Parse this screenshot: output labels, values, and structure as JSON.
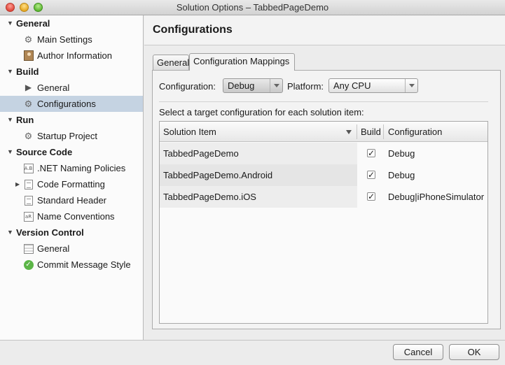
{
  "window": {
    "title": "Solution Options – TabbedPageDemo"
  },
  "sidebar": {
    "categories": [
      {
        "label": "General",
        "items": [
          {
            "label": "Main Settings",
            "icon": "gear-icon"
          },
          {
            "label": "Author Information",
            "icon": "author-icon"
          }
        ]
      },
      {
        "label": "Build",
        "items": [
          {
            "label": "General",
            "icon": "play-icon"
          },
          {
            "label": "Configurations",
            "icon": "gear-icon",
            "selected": true
          }
        ]
      },
      {
        "label": "Run",
        "items": [
          {
            "label": "Startup Project",
            "icon": "gear-icon"
          }
        ]
      },
      {
        "label": "Source Code",
        "items": [
          {
            "label": ".NET Naming Policies",
            "icon": "naming-policies-icon",
            "icon_text": "A.B"
          },
          {
            "label": "Code Formatting",
            "icon": "document-icon",
            "collapsed": true
          },
          {
            "label": "Standard Header",
            "icon": "document-icon"
          },
          {
            "label": "Name Conventions",
            "icon": "name-conventions-icon",
            "icon_text": "aR"
          }
        ]
      },
      {
        "label": "Version Control",
        "items": [
          {
            "label": "General",
            "icon": "list-icon"
          },
          {
            "label": "Commit Message Style",
            "icon": "checkmark-circle-icon"
          }
        ]
      }
    ]
  },
  "panel": {
    "title": "Configurations",
    "tabs": [
      {
        "label": "General",
        "active": false
      },
      {
        "label": "Configuration Mappings",
        "active": true
      }
    ],
    "configuration_label": "Configuration:",
    "configuration_value": "Debug",
    "platform_label": "Platform:",
    "platform_value": "Any CPU",
    "instruction": "Select a target configuration for each solution item:",
    "table": {
      "columns": [
        "Solution Item",
        "Build",
        "Configuration"
      ],
      "rows": [
        {
          "item": "TabbedPageDemo",
          "build": true,
          "configuration": "Debug"
        },
        {
          "item": "TabbedPageDemo.Android",
          "build": true,
          "configuration": "Debug"
        },
        {
          "item": "TabbedPageDemo.iOS",
          "build": true,
          "configuration": "Debug|iPhoneSimulator"
        }
      ]
    }
  },
  "footer": {
    "cancel_label": "Cancel",
    "ok_label": "OK"
  }
}
